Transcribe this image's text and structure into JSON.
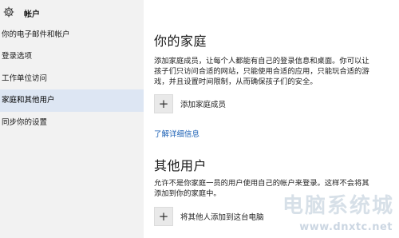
{
  "header": {
    "title": "帐户",
    "icon": "gear-icon"
  },
  "sidebar": {
    "items": [
      {
        "label": "你的电子邮件和帐户"
      },
      {
        "label": "登录选项"
      },
      {
        "label": "工作单位访问"
      },
      {
        "label": "家庭和其他用户",
        "selected": true
      },
      {
        "label": "同步你的设置"
      }
    ]
  },
  "family": {
    "heading": "你的家庭",
    "description_lines": [
      "添加家庭成员，让每个人都能有自己的登录信息和桌面。你可以让",
      "孩子们只访问合适的网站，只能使用合适的应用，只能玩合适的游",
      "戏，并且设置时间限制，从而确保孩子们的安全。"
    ],
    "add_label": "添加家庭成员",
    "learn_more": "了解详细信息"
  },
  "others": {
    "heading": "其他用户",
    "description_lines": [
      "允许不是你家庭一员的用户使用自己的帐户来登录。这样不会将其",
      "添加到你的家庭中。"
    ],
    "add_label": "将其他人添加到这台电脑"
  },
  "watermark": {
    "text": "电脑系统城",
    "url": "www.dnxtc.net"
  },
  "colors": {
    "sidebar_bg": "#f2f2f2",
    "selected_bg": "#dde6f3",
    "link": "#1a5fb4"
  }
}
